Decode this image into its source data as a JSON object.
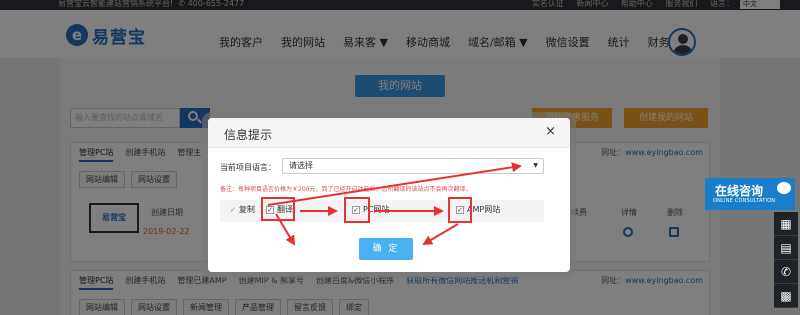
{
  "topbar": {
    "slogan": "易营宝云智能建站营销系统平台!",
    "phone": "400-655-2477",
    "links": [
      "实名认证",
      "新闻中心",
      "帮助中心",
      "服务我们"
    ],
    "lang_label": "语言：",
    "lang_value": "中文"
  },
  "header": {
    "logo_text": "易营宝",
    "nav": [
      "我的客户",
      "我的网站",
      "易来客 ▼",
      "移动商城",
      "域名/邮箱 ▼",
      "微信设置",
      "统计",
      "财务"
    ]
  },
  "main": {
    "page_title": "我的网站",
    "search_placeholder": "输入要查找的站点或域名",
    "btn_add_service": "添加优惠服务",
    "btn_create_site": "创建我的网站",
    "card1": {
      "tabs": [
        "管理PC站",
        "创建手机站",
        "管理主"
      ],
      "url_label": "网址：",
      "url": "www.eyingbao.com",
      "buttons": [
        "网站编辑",
        "网站设置"
      ],
      "thumb_logo": "易营宝",
      "col_created": "创建日期",
      "created_value": "2019-02-22",
      "col_right_headers": [
        "续费",
        "详情",
        "删除"
      ]
    },
    "card2": {
      "tabs": [
        "管理PC站",
        "创建手机站",
        "管理已建AMP",
        "创建MIP & 熊掌号",
        "创建百度&微信小程序"
      ],
      "notice": "获取所有微信网站推送机制营销",
      "url_label": "网址：",
      "url": "www.eyingbao.com",
      "buttons": [
        "网站编辑",
        "网站设置",
        "新闻管理",
        "产品管理",
        "留言反馈",
        "绑定"
      ]
    }
  },
  "floating": {
    "consult_title": "在线咨询",
    "consult_sub": "ONLINE CONSULTATION"
  },
  "modal": {
    "title": "信息提示",
    "close": "×",
    "field_label": "当前项目语言：",
    "select_value": "请选择",
    "note": "备注：每种项目语言价格为￥200元，到了已经开启功能后，您所翻译的该站点不会再次翻译。",
    "options": [
      {
        "label": "复制",
        "checked": true
      },
      {
        "label": "翻译",
        "checked": true
      },
      {
        "label": "PC网站",
        "checked": true
      },
      {
        "label": "AMP网站",
        "checked": true
      }
    ],
    "confirm": "确 定"
  },
  "colors": {
    "brand_blue": "#2a6ebd",
    "light_blue": "#4ab0f2",
    "orange": "#f3a02b",
    "annotation_red": "#e53232"
  }
}
